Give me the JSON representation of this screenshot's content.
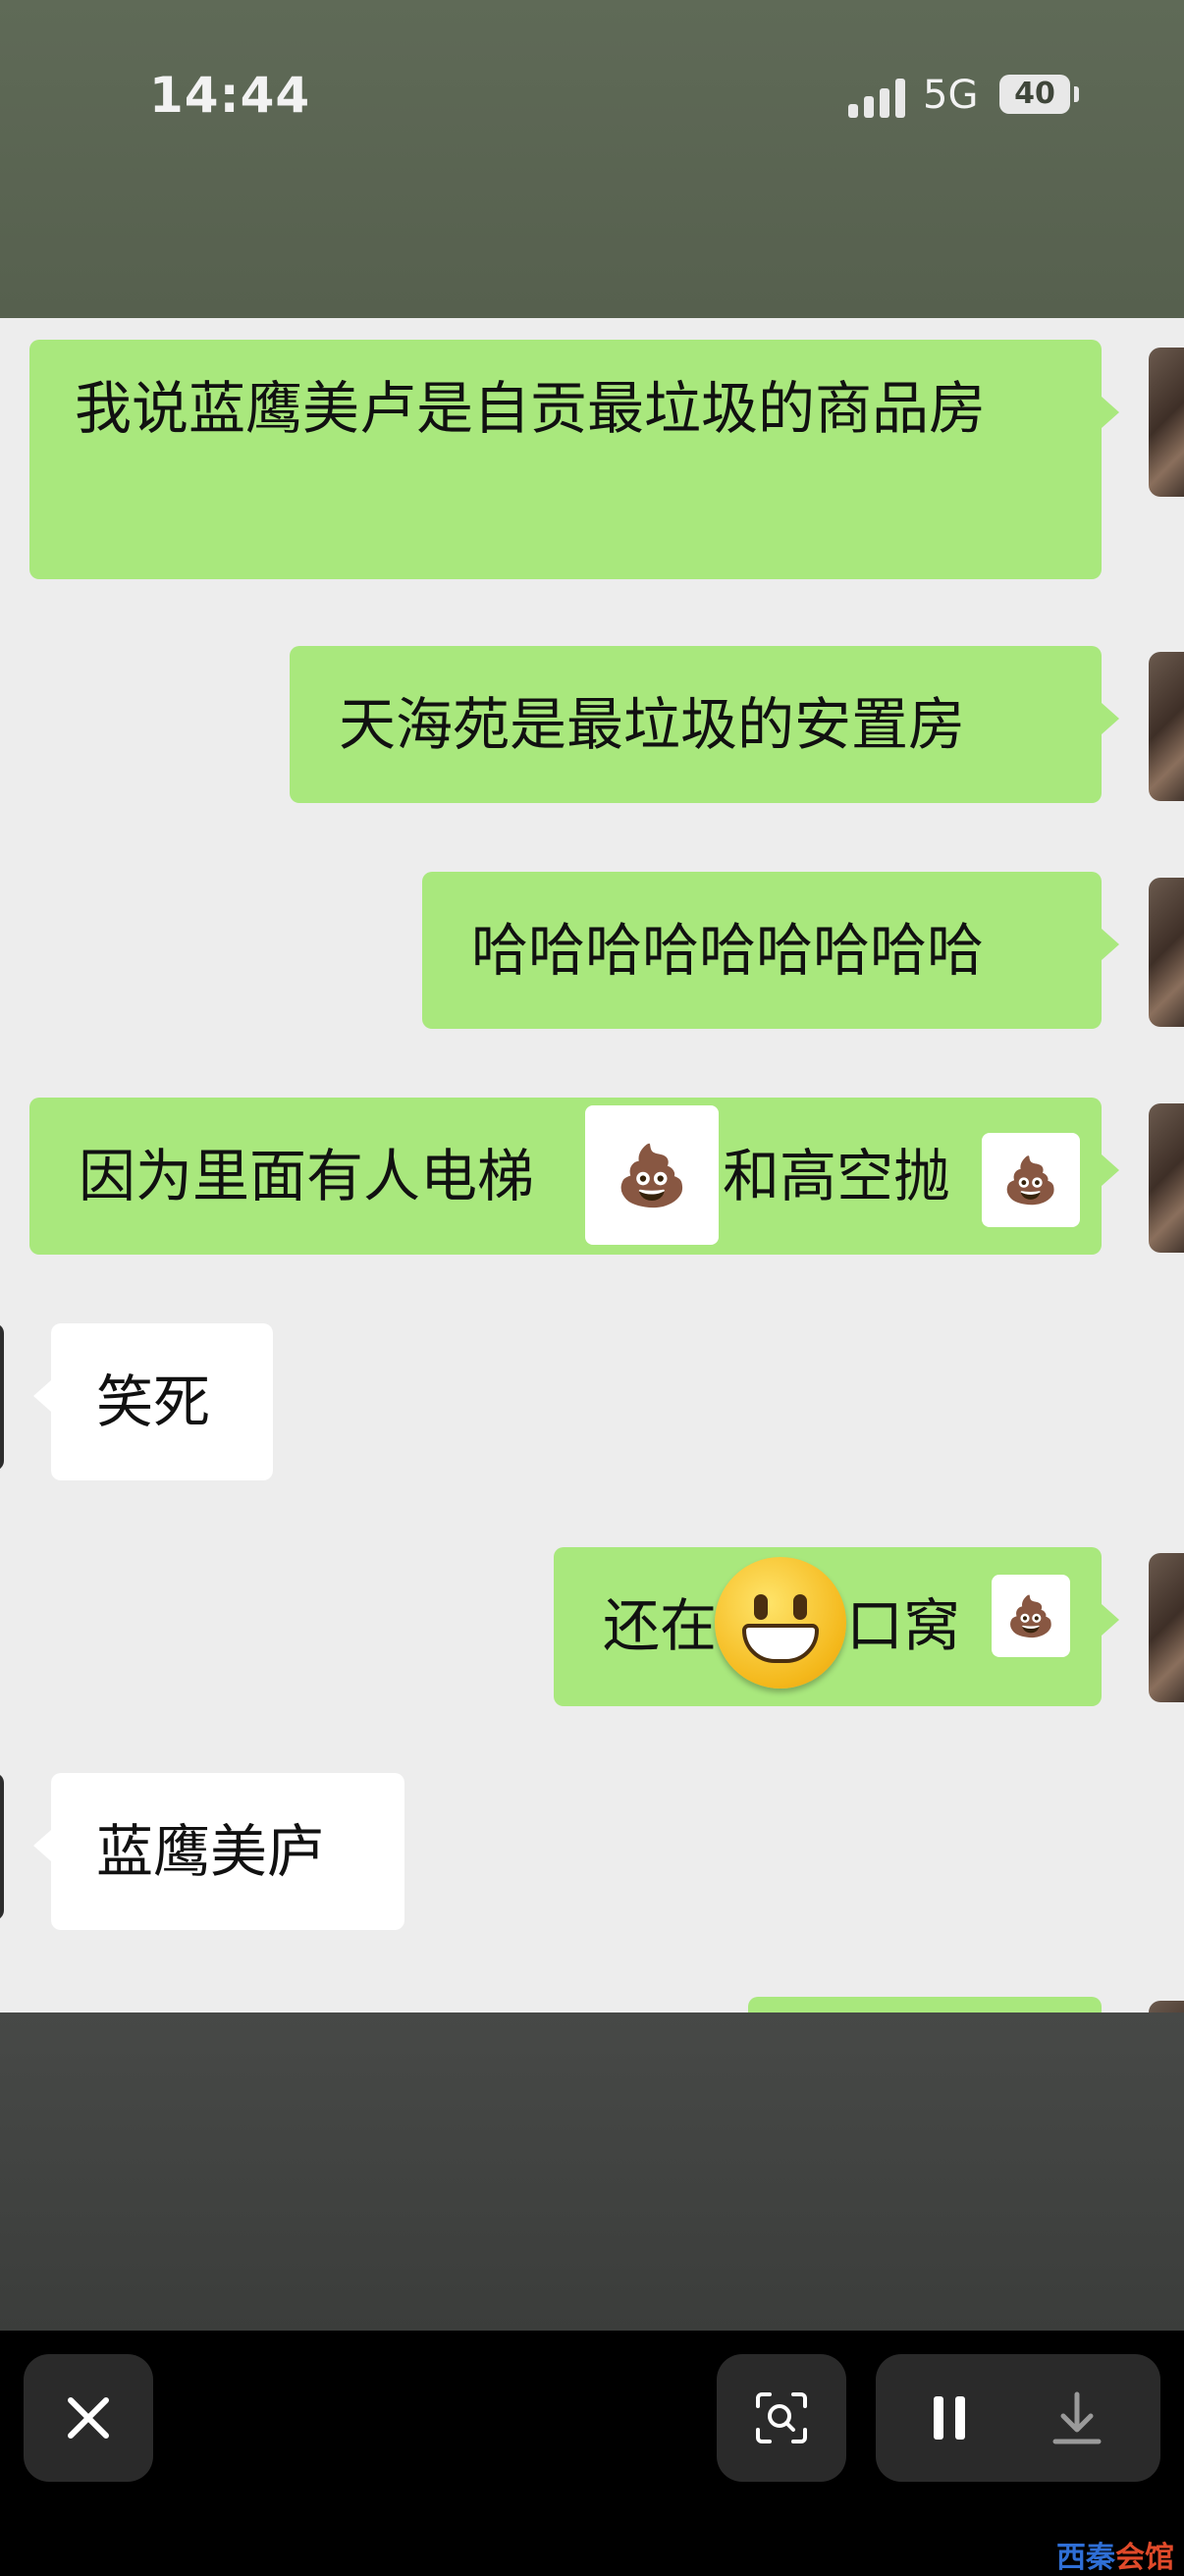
{
  "status_bar": {
    "time": "14:44",
    "network": "5G",
    "battery": "40"
  },
  "messages": [
    {
      "side": "sent",
      "text": "我说蓝鹰美卢是自贡最垃圾的商品房"
    },
    {
      "side": "sent",
      "text": "天海苑是最垃圾的安置房"
    },
    {
      "side": "sent",
      "text": "哈哈哈哈哈哈哈哈哈"
    },
    {
      "side": "sent",
      "text": "因为里面有人电梯",
      "text_after": "和高空抛"
    },
    {
      "side": "received",
      "text": "笑死"
    },
    {
      "side": "sent",
      "text": "还在",
      "text_after": "门口窝"
    },
    {
      "side": "received",
      "text": "蓝鹰美庐"
    }
  ],
  "icons": {
    "close": "close-icon",
    "scan": "scan-icon",
    "pause": "pause-icon",
    "download": "download-icon",
    "poo": "💩"
  },
  "watermark": {
    "part1": "西秦",
    "part2": "会馆"
  },
  "colors": {
    "sent_bubble": "#a9e87d",
    "received_bubble": "#ffffff",
    "chat_bg": "#ededed"
  }
}
